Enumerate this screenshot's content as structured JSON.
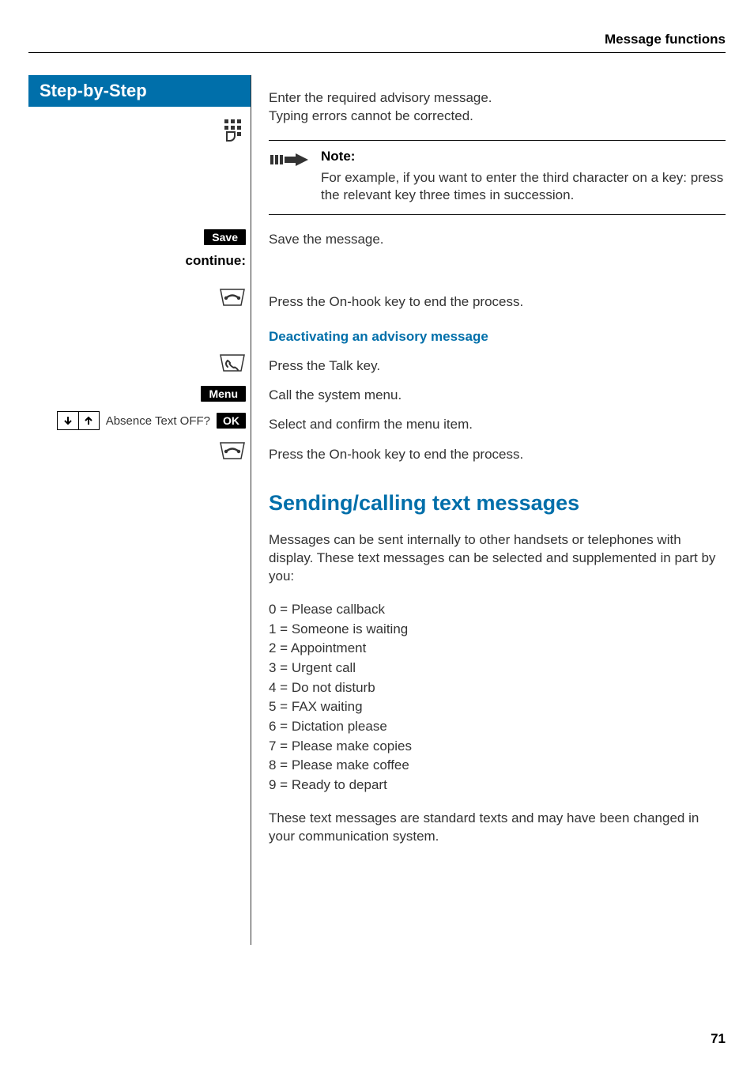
{
  "header": {
    "section_title": "Message functions"
  },
  "step_header": "Step-by-Step",
  "intro": {
    "line1": "Enter the required advisory message.",
    "line2": "Typing errors cannot be corrected."
  },
  "note": {
    "title": "Note:",
    "body": "For example, if you want to enter the third char­acter on a key: press the relevant key three times in succession."
  },
  "save": {
    "pill": "Save",
    "text": "Save the message."
  },
  "continue_label": "continue:",
  "onhook1": "Press the On-hook key to end the process.",
  "deactivate_heading": "Deactivating an advisory message",
  "talk": "Press the Talk key.",
  "menu": {
    "pill": "Menu",
    "text": "Call the system menu."
  },
  "absence": {
    "display": "Absence Text OFF?",
    "ok": "OK",
    "text": "Select and confirm the menu item."
  },
  "onhook2": "Press the On-hook key to end the process.",
  "section2": {
    "heading": "Sending/calling text messages",
    "intro": "Messages can be sent internally to other handsets or telephones with display. These text messages can be selected and supplemented in part by you:",
    "items": [
      "0 = Please callback",
      "1 = Someone is waiting",
      "2 = Appointment",
      "3 = Urgent call",
      "4 = Do not disturb",
      "5 = FAX waiting",
      "6 = Dictation please",
      "7 = Please make copies",
      "8 = Please make coffee",
      "9 = Ready to depart"
    ],
    "outro": "These text messages are standard texts and may have been changed in your communication system."
  },
  "page_number": "71"
}
